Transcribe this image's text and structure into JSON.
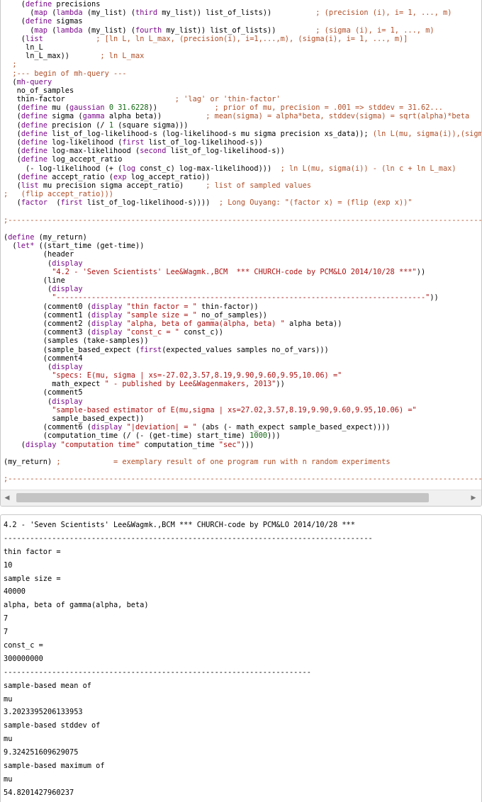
{
  "editor": {
    "lines": [
      [
        [
          "p",
          "    ("
        ],
        [
          "k",
          "define"
        ],
        [
          "p",
          " precisions"
        ]
      ],
      [
        [
          "p",
          "      ("
        ],
        [
          "k",
          "map"
        ],
        [
          "p",
          " ("
        ],
        [
          "k",
          "lambda"
        ],
        [
          "p",
          " (my_list) ("
        ],
        [
          "k",
          "third"
        ],
        [
          "p",
          " my_list)) list_of_lists))          "
        ],
        [
          "c",
          "; (precision (i), i= 1, ..., m)"
        ]
      ],
      [
        [
          "p",
          "    ("
        ],
        [
          "k",
          "define"
        ],
        [
          "p",
          " sigmas"
        ]
      ],
      [
        [
          "p",
          "      ("
        ],
        [
          "k",
          "map"
        ],
        [
          "p",
          " ("
        ],
        [
          "k",
          "lambda"
        ],
        [
          "p",
          " (my_list) ("
        ],
        [
          "k",
          "fourth"
        ],
        [
          "p",
          " my_list)) list_of_lists))         "
        ],
        [
          "c",
          "; (sigma (i), i= 1, ..., m)"
        ]
      ],
      [
        [
          "p",
          "    ("
        ],
        [
          "k",
          "list"
        ],
        [
          "p",
          "            "
        ],
        [
          "c",
          "; [ln L, ln L_max, (precision(i), i=1,...,m), (sigma(i), i= 1, ..., m)]"
        ]
      ],
      [
        [
          "p",
          "     ln_L"
        ]
      ],
      [
        [
          "p",
          "     ln_L_max))       "
        ],
        [
          "c",
          "; ln L_max"
        ]
      ],
      [
        [
          "p",
          "  "
        ],
        [
          "c",
          ";"
        ]
      ],
      [
        [
          "p",
          "  "
        ],
        [
          "c",
          ";--- begin of mh-query ---"
        ]
      ],
      [
        [
          "p",
          "  ("
        ],
        [
          "k",
          "mh-query"
        ]
      ],
      [
        [
          "p",
          "   no_of_samples"
        ]
      ],
      [
        [
          "p",
          "   thin-factor                         "
        ],
        [
          "c",
          "; 'lag' or 'thin-factor'"
        ]
      ],
      [
        [
          "p",
          "   ("
        ],
        [
          "k",
          "define"
        ],
        [
          "p",
          " mu ("
        ],
        [
          "k",
          "gaussian"
        ],
        [
          "p",
          " "
        ],
        [
          "n",
          "0"
        ],
        [
          "p",
          " "
        ],
        [
          "n",
          "31.6228"
        ],
        [
          "p",
          "))             "
        ],
        [
          "c",
          "; prior of mu, precision = .001 => stddev = 31.62..."
        ]
      ],
      [
        [
          "p",
          "   ("
        ],
        [
          "k",
          "define"
        ],
        [
          "p",
          " sigma ("
        ],
        [
          "k",
          "gamma"
        ],
        [
          "p",
          " alpha beta))          "
        ],
        [
          "c",
          "; mean(sigma) = alpha*beta, stddev(sigma) = sqrt(alpha)*beta"
        ]
      ],
      [
        [
          "p",
          "   ("
        ],
        [
          "k",
          "define"
        ],
        [
          "p",
          " precision (/ "
        ],
        [
          "n",
          "1"
        ],
        [
          "p",
          " (square sigma)))"
        ]
      ],
      [
        [
          "p",
          "   ("
        ],
        [
          "k",
          "define"
        ],
        [
          "p",
          " list_of_log-likelihood-s (log-likelihood-s mu sigma precision xs_data)); "
        ],
        [
          "c",
          "(ln L(mu, sigma(i)),(sigma("
        ]
      ],
      [
        [
          "p",
          "   ("
        ],
        [
          "k",
          "define"
        ],
        [
          "p",
          " log-likelihood ("
        ],
        [
          "k",
          "first"
        ],
        [
          "p",
          " list_of_log-likelihood-s))"
        ]
      ],
      [
        [
          "p",
          "   ("
        ],
        [
          "k",
          "define"
        ],
        [
          "p",
          " log-max-likelihood ("
        ],
        [
          "k",
          "second"
        ],
        [
          "p",
          " list_of_log-likelihood-s))"
        ]
      ],
      [
        [
          "p",
          "   ("
        ],
        [
          "k",
          "define"
        ],
        [
          "p",
          " log_accept_ratio"
        ]
      ],
      [
        [
          "p",
          "     (- log-likelihood (+ ("
        ],
        [
          "k",
          "log"
        ],
        [
          "p",
          " const_c) log-max-likelihood)))  "
        ],
        [
          "c",
          "; ln L(mu, sigma(i)) - (ln c + ln L_max)"
        ]
      ],
      [
        [
          "p",
          "   ("
        ],
        [
          "k",
          "define"
        ],
        [
          "p",
          " accept_ratio ("
        ],
        [
          "k",
          "exp"
        ],
        [
          "p",
          " log_accept_ratio))"
        ]
      ],
      [
        [
          "p",
          "   ("
        ],
        [
          "k",
          "list"
        ],
        [
          "p",
          " mu precision sigma accept_ratio)     "
        ],
        [
          "c",
          "; list of sampled values"
        ]
      ],
      [
        [
          "c",
          ";   (flip accept_ratio)))"
        ]
      ],
      [
        [
          "p",
          "   ("
        ],
        [
          "k",
          "factor"
        ],
        [
          "p",
          "  ("
        ],
        [
          "k",
          "first"
        ],
        [
          "p",
          " list_of_log-likelihood-s))))  "
        ],
        [
          "c",
          "; Long Ouyang: \"(factor x) = (flip (exp x))\""
        ]
      ],
      [
        [
          "p",
          ""
        ]
      ],
      [
        [
          "c",
          ";--------------------------------------------------------------------------------------------------------------"
        ]
      ],
      [
        [
          "p",
          ""
        ]
      ],
      [
        [
          "p",
          "("
        ],
        [
          "k",
          "define"
        ],
        [
          "p",
          " (my_return)"
        ]
      ],
      [
        [
          "p",
          "  ("
        ],
        [
          "k",
          "let*"
        ],
        [
          "p",
          " ((start_time (get-time))"
        ]
      ],
      [
        [
          "p",
          "         (header"
        ]
      ],
      [
        [
          "p",
          "          ("
        ],
        [
          "k",
          "display"
        ]
      ],
      [
        [
          "p",
          "           "
        ],
        [
          "s",
          "\"4.2 - 'Seven Scientists' Lee&Wagmk.,BCM  *** CHURCH-code by PCM&LO 2014/10/28 ***\""
        ],
        [
          "p",
          "))"
        ]
      ],
      [
        [
          "p",
          "         (line"
        ]
      ],
      [
        [
          "p",
          "          ("
        ],
        [
          "k",
          "display"
        ]
      ],
      [
        [
          "p",
          "           "
        ],
        [
          "s",
          "\"------------------------------------------------------------------------------------\""
        ],
        [
          "p",
          "))"
        ]
      ],
      [
        [
          "p",
          "         (comment0 ("
        ],
        [
          "k",
          "display"
        ],
        [
          "p",
          " "
        ],
        [
          "s",
          "\"thin factor = \""
        ],
        [
          "p",
          " thin-factor))"
        ]
      ],
      [
        [
          "p",
          "         (comment1 ("
        ],
        [
          "k",
          "display"
        ],
        [
          "p",
          " "
        ],
        [
          "s",
          "\"sample size = \""
        ],
        [
          "p",
          " no_of_samples))"
        ]
      ],
      [
        [
          "p",
          "         (comment2 ("
        ],
        [
          "k",
          "display"
        ],
        [
          "p",
          " "
        ],
        [
          "s",
          "\"alpha, beta of gamma(alpha, beta) \""
        ],
        [
          "p",
          " alpha beta))"
        ]
      ],
      [
        [
          "p",
          "         (comment3 ("
        ],
        [
          "k",
          "display"
        ],
        [
          "p",
          " "
        ],
        [
          "s",
          "\"const_c = \""
        ],
        [
          "p",
          " const_c))"
        ]
      ],
      [
        [
          "p",
          "         (samples (take-samples))"
        ]
      ],
      [
        [
          "p",
          "         (sample_based_expect ("
        ],
        [
          "k",
          "first"
        ],
        [
          "p",
          "(expected_values samples no_of_vars)))"
        ]
      ],
      [
        [
          "p",
          "         (comment4"
        ]
      ],
      [
        [
          "p",
          "          ("
        ],
        [
          "k",
          "display"
        ]
      ],
      [
        [
          "p",
          "           "
        ],
        [
          "s",
          "\"specs: E(mu, sigma | xs=-27.02,3.57,8.19,9.90,9.60,9.95,10.06) =\""
        ]
      ],
      [
        [
          "p",
          "           math_expect "
        ],
        [
          "s",
          "\" - published by Lee&Wagenmakers, 2013\""
        ],
        [
          "p",
          "))"
        ]
      ],
      [
        [
          "p",
          "         (comment5"
        ]
      ],
      [
        [
          "p",
          "          ("
        ],
        [
          "k",
          "display"
        ]
      ],
      [
        [
          "p",
          "           "
        ],
        [
          "s",
          "\"sample-based estimator of E(mu,sigma | xs=27.02,3.57,8.19,9.90,9.60,9.95,10.06) =\""
        ]
      ],
      [
        [
          "p",
          "           sample_based_expect))"
        ]
      ],
      [
        [
          "p",
          "         (comment6 ("
        ],
        [
          "k",
          "display"
        ],
        [
          "p",
          " "
        ],
        [
          "s",
          "\"|deviation| = \""
        ],
        [
          "p",
          " (abs (- math_expect sample_based_expect))))"
        ]
      ],
      [
        [
          "p",
          "         (computation_time (/ (- (get-time) start_time) "
        ],
        [
          "n",
          "1000"
        ],
        [
          "p",
          ")))"
        ]
      ],
      [
        [
          "p",
          "    ("
        ],
        [
          "k",
          "display"
        ],
        [
          "p",
          " "
        ],
        [
          "s",
          "\"computation time\""
        ],
        [
          "p",
          " computation_time "
        ],
        [
          "s",
          "\"sec\""
        ],
        [
          "p",
          ")))"
        ]
      ],
      [
        [
          "p",
          ""
        ]
      ],
      [
        [
          "p",
          "(my_return) "
        ],
        [
          "c",
          ";            = exemplary result of one program run with n random experiments"
        ]
      ],
      [
        [
          "p",
          ""
        ]
      ],
      [
        [
          "c",
          ";--------------------------------------------------------------------------------------------------------------"
        ]
      ]
    ]
  },
  "scrollbar": {
    "left_arrow": "◀",
    "right_arrow": "▶"
  },
  "output": {
    "lines": [
      "4.2 - 'Seven Scientists' Lee&Wagmk.,BCM *** CHURCH-code by PCM&LO 2014/10/28 ***",
      "------------------------------------------------------------------------------------",
      "thin factor =",
      "10",
      "sample size =",
      "40000",
      "alpha, beta of gamma(alpha, beta)",
      "7",
      "7",
      "const_c =",
      "300000000",
      "----------------------------------------------------------------------",
      "sample-based mean of",
      "mu",
      "3.2023395206133953",
      "sample-based stddev of",
      "mu",
      "9.324251609629075",
      "sample-based maximum of",
      "mu",
      "54.8201427960237"
    ]
  }
}
